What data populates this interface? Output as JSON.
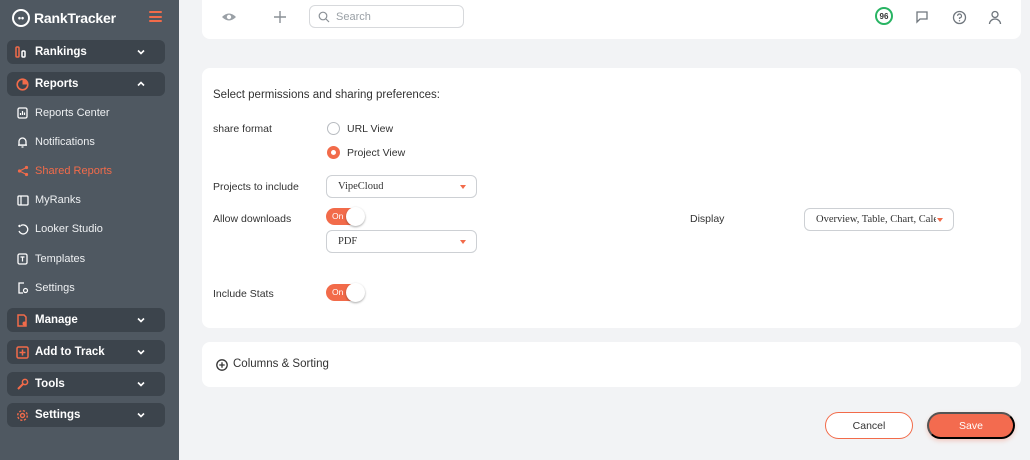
{
  "app": {
    "logo_text": "RankTracker",
    "logo_prefix": "••"
  },
  "sidebar": {
    "groups": [
      {
        "label": "Rankings",
        "icon": "rankings-icon"
      },
      {
        "label": "Reports",
        "icon": "reports-icon",
        "expanded": true
      },
      {
        "label": "Manage",
        "icon": "manage-icon"
      },
      {
        "label": "Add to Track",
        "icon": "add-to-track-icon"
      },
      {
        "label": "Tools",
        "icon": "tools-icon"
      },
      {
        "label": "Settings",
        "icon": "settings-icon"
      }
    ],
    "report_items": [
      {
        "label": "Reports Center",
        "icon": "reports-center-icon"
      },
      {
        "label": "Notifications",
        "icon": "bell-icon"
      },
      {
        "label": "Shared Reports",
        "icon": "share-icon",
        "active": true
      },
      {
        "label": "MyRanks",
        "icon": "myranks-icon"
      },
      {
        "label": "Looker Studio",
        "icon": "looker-studio-icon"
      },
      {
        "label": "Templates",
        "icon": "templates-icon"
      },
      {
        "label": "Settings",
        "icon": "report-settings-icon"
      }
    ]
  },
  "topbar": {
    "search_placeholder": "Search",
    "score": "96",
    "icons": [
      "eye-icon",
      "plus-icon",
      "search-icon",
      "score-badge",
      "message-icon",
      "help-icon",
      "user-icon"
    ]
  },
  "form": {
    "heading": "Select permissions and sharing preferences:",
    "share_format": {
      "label": "share format",
      "options": [
        {
          "label": "URL View",
          "selected": false
        },
        {
          "label": "Project View",
          "selected": true
        }
      ]
    },
    "projects": {
      "label": "Projects to include",
      "value": "VipeCloud"
    },
    "downloads": {
      "label": "Allow downloads",
      "toggle": "On",
      "format": "PDF"
    },
    "display": {
      "label": "Display",
      "value": "Overview, Table, Chart, Calendar"
    },
    "stats": {
      "label": "Include Stats",
      "toggle": "On"
    }
  },
  "columns": {
    "label": "Columns & Sorting"
  },
  "actions": {
    "cancel": "Cancel",
    "save": "Save"
  },
  "colors": {
    "accent": "#f26b4a",
    "sidebar_bg": "#4f5861",
    "group_bg": "#3c444c",
    "score_ring": "#28b463",
    "page_bg": "#f2f3f5"
  }
}
